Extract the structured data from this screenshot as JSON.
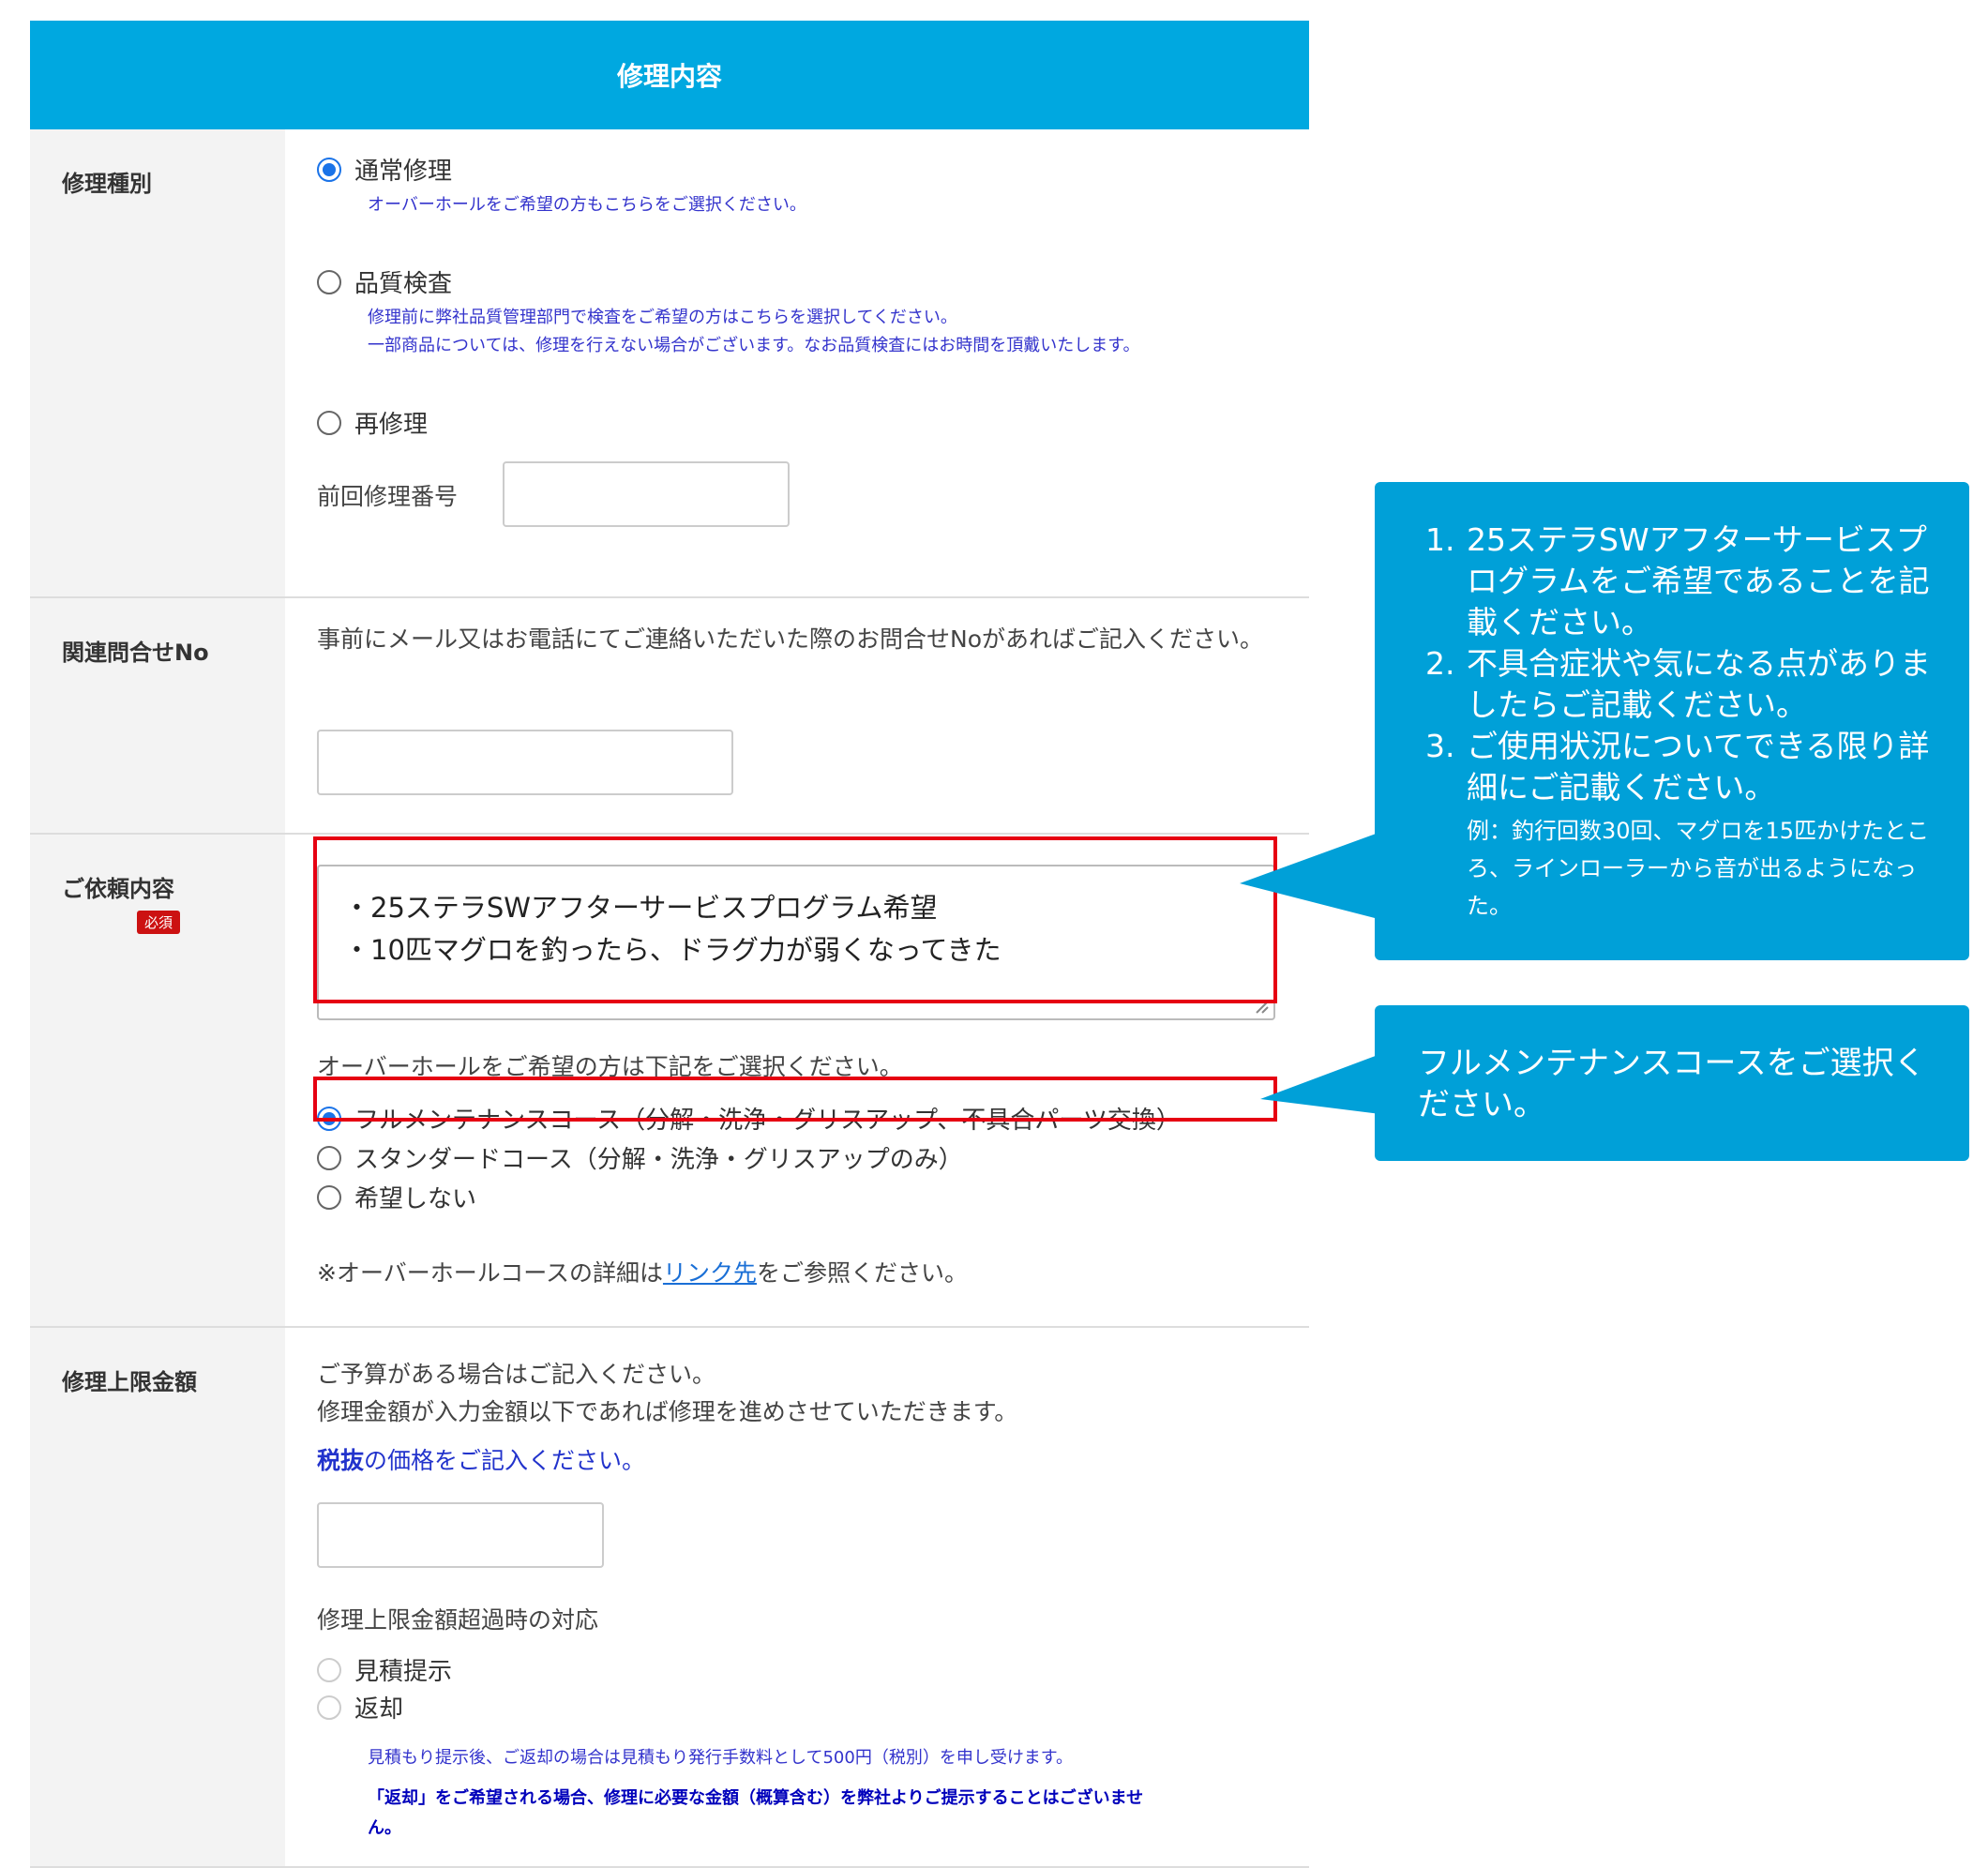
{
  "header": {
    "title": "修理内容"
  },
  "repair_type": {
    "label": "修理種別",
    "options": [
      {
        "label": "通常修理",
        "note": "オーバーホールをご希望の方もこちらをご選択ください。",
        "checked": true
      },
      {
        "label": "品質検査",
        "note_line1": "修理前に弊社品質管理部門で検査をご希望の方はこちらを選択してください。",
        "note_line2": "一部商品については、修理を行えない場合がございます。なお品質検査にはお時間を頂戴いたします。",
        "checked": false
      },
      {
        "label": "再修理",
        "checked": false
      }
    ],
    "previous_number_label": "前回修理番号",
    "previous_number_value": ""
  },
  "inquiry": {
    "label": "関連問合せNo",
    "description": "事前にメール又はお電話にてご連絡いただいた際のお問合せNoがあればご記入ください。",
    "value": ""
  },
  "request": {
    "label": "ご依頼内容",
    "required_badge": "必須",
    "text_line1": "・25ステラSWアフターサービスプログラム希望",
    "text_line2": "・10匹マグロを釣ったら、ドラグ力が弱くなってきた",
    "overhaul_prompt": "オーバーホールをご希望の方は下記をご選択ください。",
    "courses": [
      {
        "label": "フルメンテナンスコース（分解・洗浄・グリスアップ、不具合パーツ交換）",
        "checked": true
      },
      {
        "label": "スタンダードコース（分解・洗浄・グリスアップのみ）",
        "checked": false
      },
      {
        "label": "希望しない",
        "checked": false
      }
    ],
    "detail_prefix": "※オーバーホールコースの詳細は",
    "detail_link": "リンク先",
    "detail_suffix": "をご参照ください。"
  },
  "limit": {
    "label": "修理上限金額",
    "desc_line1": "ご予算がある場合はご記入ください。",
    "desc_line2": "修理金額が入力金額以下であれば修理を進めさせていただきます。",
    "tax_bold": "税抜",
    "tax_rest": "の価格をご記入ください。",
    "value": "",
    "exceed_label": "修理上限金額超過時の対応",
    "exceed_options": [
      {
        "label": "見積提示",
        "checked": false
      },
      {
        "label": "返却",
        "checked": false
      }
    ],
    "note1": "見積もり提示後、ご返却の場合は見積もり発行手数料として500円（税別）を申し受けます。",
    "note2_line1": "「返却」をご希望される場合、修理に必要な金額（概算含む）を弊社よりご提示することはございませ",
    "note2_line2": "ん。"
  },
  "callouts": {
    "main": {
      "items": [
        {
          "num": "1.",
          "text": "25ステラSWアフターサービスプログラムをご希望であることを記載ください。"
        },
        {
          "num": "2.",
          "text": "不具合症状や気になる点がありましたらご記載ください。"
        },
        {
          "num": "3.",
          "text": "ご使用状況についてできる限り詳細にご記載ください。"
        }
      ],
      "example": "例：釣行回数30回、マグロを15匹かけたところ、ラインローラーから音が出るようになった。"
    },
    "course": {
      "text": "フルメンテナンスコースをご選択ください。"
    }
  },
  "colors": {
    "header_bg": "#00a8e0",
    "callout_bg": "#00a0d8",
    "highlight": "#e60012",
    "note_blue": "#3333cc"
  }
}
